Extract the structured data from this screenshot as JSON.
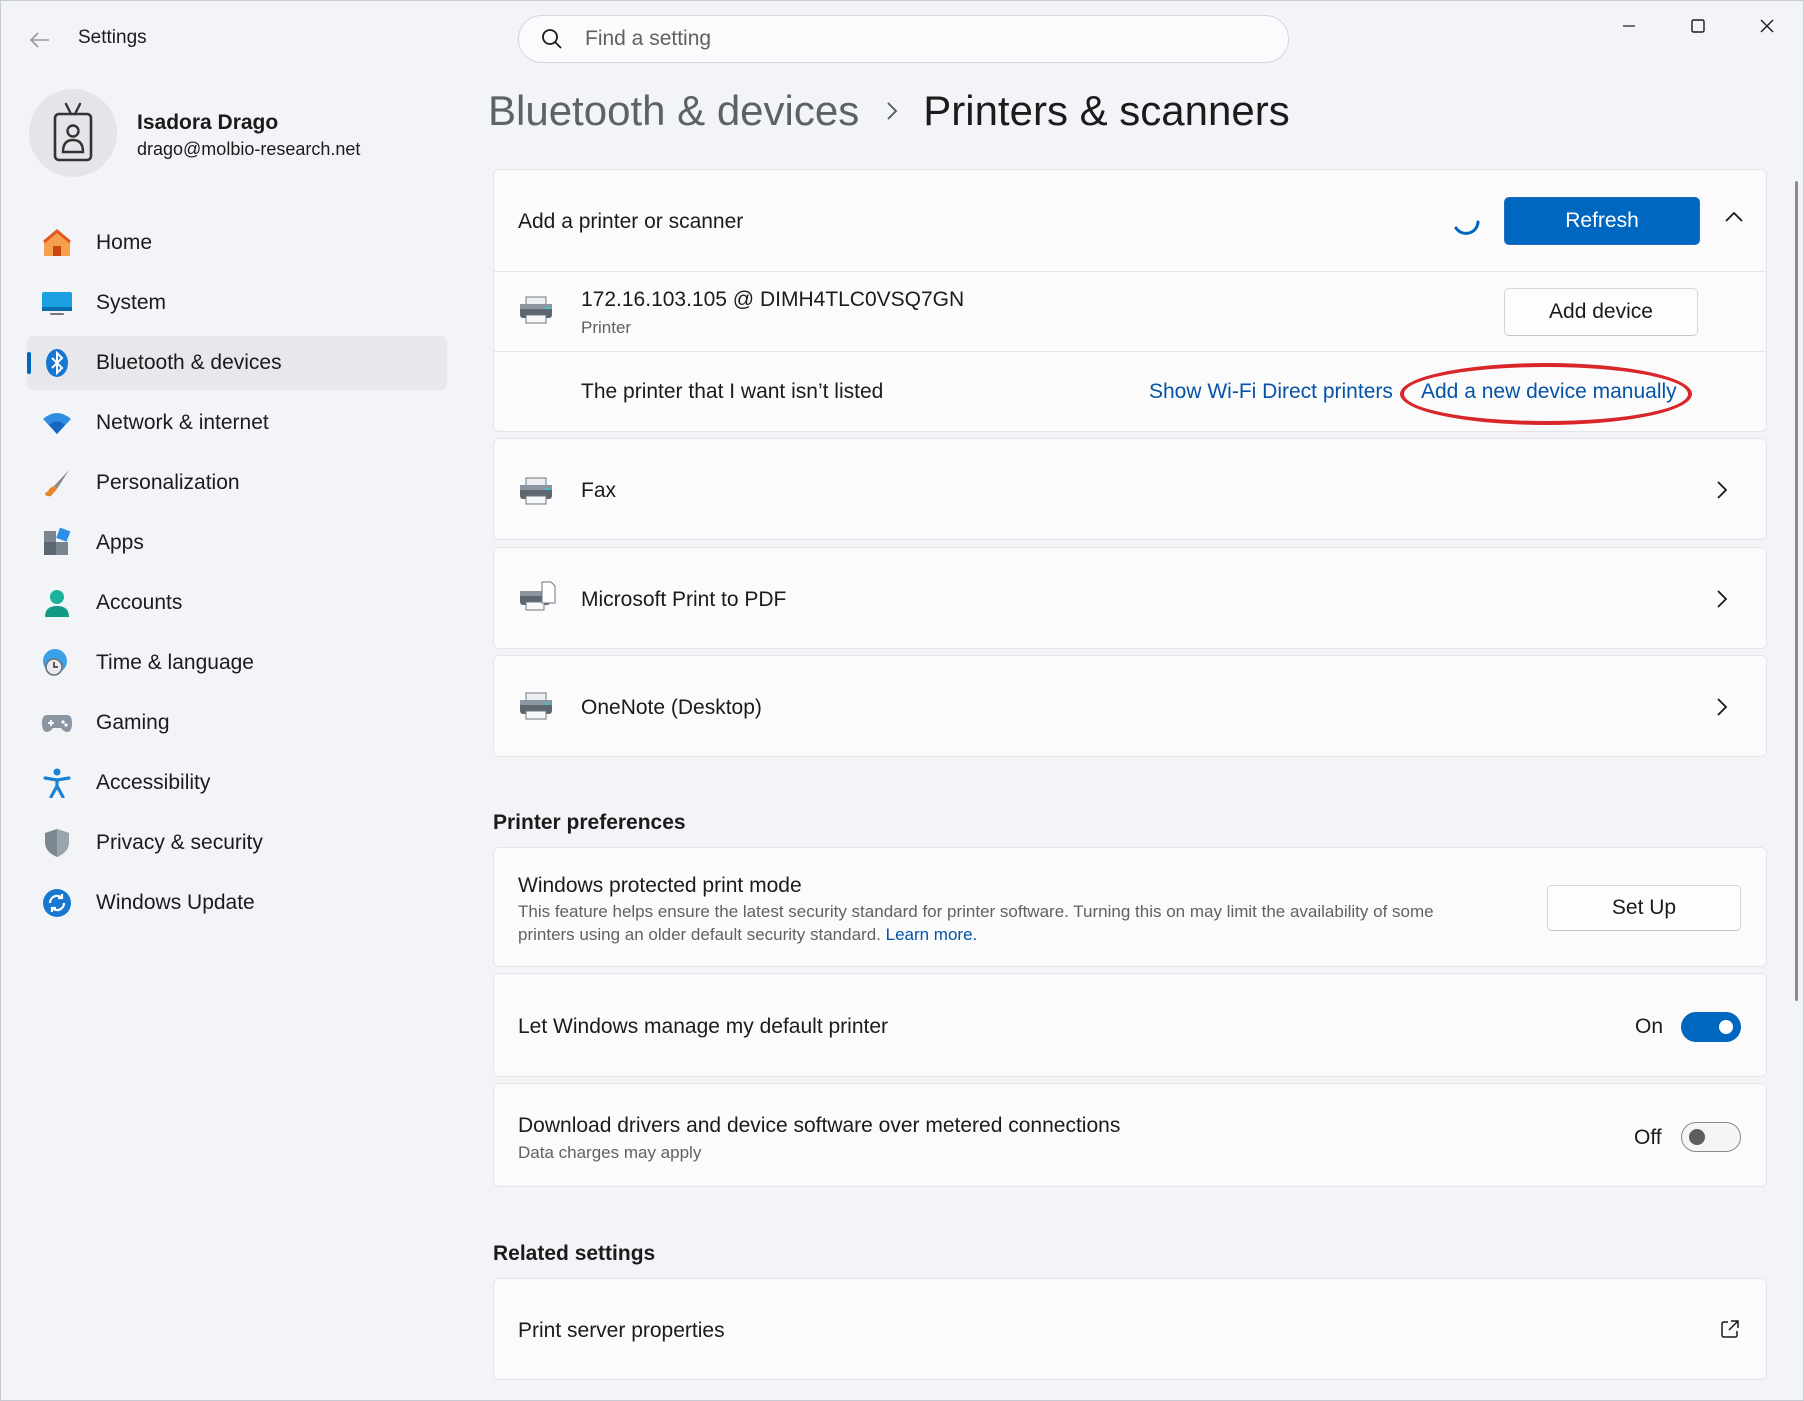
{
  "window": {
    "app_title": "Settings",
    "search_placeholder": "Find a setting"
  },
  "user": {
    "name": "Isadora Drago",
    "email": "drago@molbio-research.net"
  },
  "nav": [
    {
      "label": "Home",
      "icon": "home-icon"
    },
    {
      "label": "System",
      "icon": "system-icon"
    },
    {
      "label": "Bluetooth & devices",
      "icon": "bluetooth-icon",
      "active": true
    },
    {
      "label": "Network & internet",
      "icon": "wifi-icon"
    },
    {
      "label": "Personalization",
      "icon": "brush-icon"
    },
    {
      "label": "Apps",
      "icon": "apps-icon"
    },
    {
      "label": "Accounts",
      "icon": "accounts-icon"
    },
    {
      "label": "Time & language",
      "icon": "time-language-icon"
    },
    {
      "label": "Gaming",
      "icon": "gaming-icon"
    },
    {
      "label": "Accessibility",
      "icon": "accessibility-icon"
    },
    {
      "label": "Privacy & security",
      "icon": "shield-icon"
    },
    {
      "label": "Windows Update",
      "icon": "update-icon"
    }
  ],
  "breadcrumb": {
    "parent": "Bluetooth & devices",
    "current": "Printers & scanners"
  },
  "add_printer": {
    "title": "Add a printer or scanner",
    "refresh_label": "Refresh",
    "found_device": {
      "name": "172.16.103.105 @ DIMH4TLC0VSQ7GN",
      "type": "Printer",
      "add_label": "Add device"
    },
    "not_listed_text": "The printer that I want isn’t listed",
    "wifi_direct_link": "Show Wi-Fi Direct printers",
    "manual_link": "Add a new device manually"
  },
  "printers": [
    {
      "name": "Fax"
    },
    {
      "name": "Microsoft Print to PDF"
    },
    {
      "name": "OneNote (Desktop)"
    }
  ],
  "preferences": {
    "heading": "Printer preferences",
    "protected_mode": {
      "title": "Windows protected print mode",
      "description": "This feature helps ensure the latest security standard for printer software. Turning this on may limit the availability of some",
      "description_line2": "printers using an older default security standard.",
      "learn_more": "Learn more.",
      "button": "Set Up"
    },
    "default_printer": {
      "title": "Let Windows manage my default printer",
      "state": "On"
    },
    "metered": {
      "title": "Download drivers and device software over metered connections",
      "subtitle": "Data charges may apply",
      "state": "Off"
    }
  },
  "related": {
    "heading": "Related settings",
    "print_server": "Print server properties"
  },
  "colors": {
    "accent": "#0067c0",
    "link": "#0553a8",
    "annotation": "#d9262a"
  }
}
